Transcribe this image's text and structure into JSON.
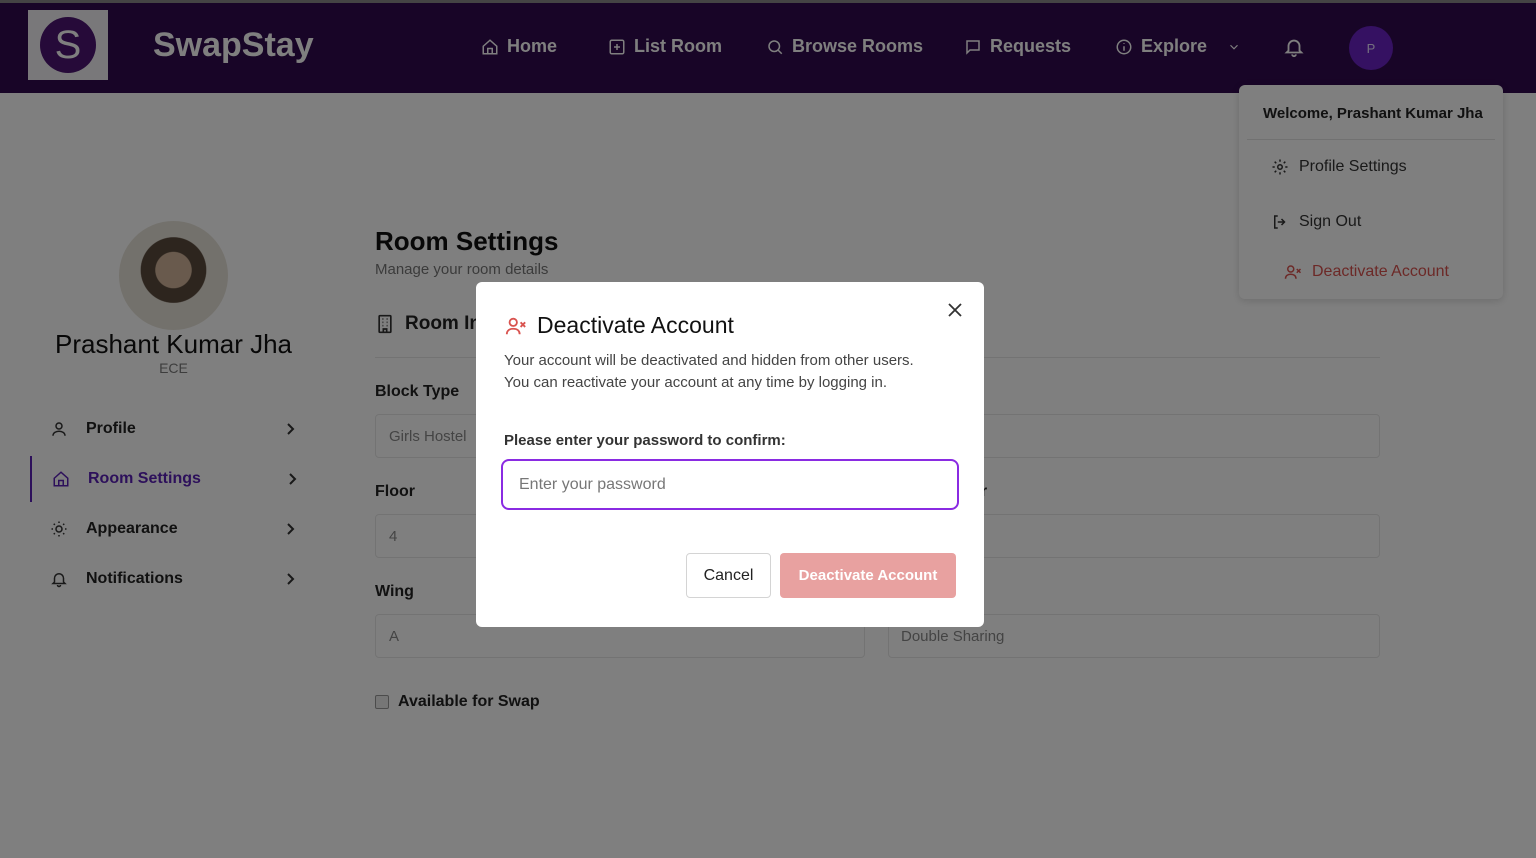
{
  "brand": {
    "logo_letter": "S",
    "name": "SwapStay"
  },
  "nav": {
    "items": [
      {
        "label": "Home",
        "icon": "home-icon"
      },
      {
        "label": "List Room",
        "icon": "plus-square-icon"
      },
      {
        "label": "Browse Rooms",
        "icon": "search-icon"
      },
      {
        "label": "Requests",
        "icon": "message-icon"
      },
      {
        "label": "Explore",
        "icon": "info-icon"
      }
    ],
    "avatar_letter": "P"
  },
  "sidebar": {
    "name": "Prashant Kumar Jha",
    "department": "ECE",
    "items": [
      {
        "label": "Profile",
        "icon": "user-icon"
      },
      {
        "label": "Room Settings",
        "icon": "home-icon",
        "active": true
      },
      {
        "label": "Appearance",
        "icon": "sun-icon"
      },
      {
        "label": "Notifications",
        "icon": "bell-icon"
      }
    ]
  },
  "main": {
    "title": "Room Settings",
    "subtitle": "Manage your room details",
    "section_title": "Room In",
    "fields": {
      "block_type_label": "Block Type",
      "block_type_value": "Girls Hostel",
      "floor_label": "Floor",
      "floor_value": "4",
      "room_number_label_tail": "er",
      "wing_label": "Wing",
      "wing_value": "A",
      "room_type_value": "Double Sharing"
    },
    "available_label": "Available for Swap"
  },
  "dropdown": {
    "welcome": "Welcome, Prashant Kumar Jha",
    "profile_settings": "Profile Settings",
    "sign_out": "Sign Out",
    "deactivate": "Deactivate Account"
  },
  "modal": {
    "title": "Deactivate Account",
    "description_1": "Your account will be deactivated and hidden from other users.",
    "description_2": "You can reactivate your account at any time by logging in.",
    "password_label": "Please enter your password to confirm:",
    "password_placeholder": "Enter your password",
    "cancel_label": "Cancel",
    "confirm_label": "Deactivate Account"
  },
  "colors": {
    "nav_bg": "#300a4e",
    "accent": "#5b21b6",
    "danger": "#d9534f",
    "danger_disabled": "#e8a1a0",
    "focus": "#8a2be2"
  }
}
